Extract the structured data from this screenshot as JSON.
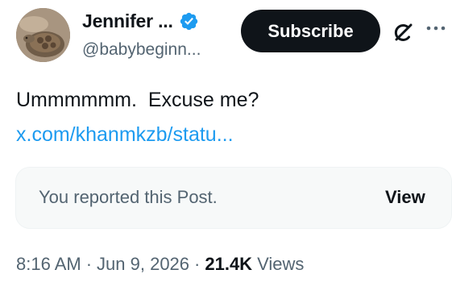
{
  "author": {
    "display_name": "Jennifer ...",
    "handle": "@babybeginn...",
    "verified": true,
    "avatar_icon": "tortoise-avatar"
  },
  "actions": {
    "subscribe_label": "Subscribe",
    "grok_icon": "grok-icon",
    "more_icon": "more-icon"
  },
  "tweet": {
    "text": "Ummmmmm.  Excuse me?",
    "link": "x.com/khanmkzb/statu..."
  },
  "reported_notice": {
    "text": "You reported this Post.",
    "view_label": "View"
  },
  "meta": {
    "time": "8:16 AM",
    "separator": "·",
    "date": "Jun 9, 2026",
    "views_count": "21.4K",
    "views_label": "Views"
  },
  "colors": {
    "text_primary": "#0f1419",
    "text_secondary": "#536471",
    "link": "#1d9bf0",
    "verified": "#1d9bf0",
    "button_dark": "#0f1419",
    "card_bg": "#f7f9f9"
  }
}
